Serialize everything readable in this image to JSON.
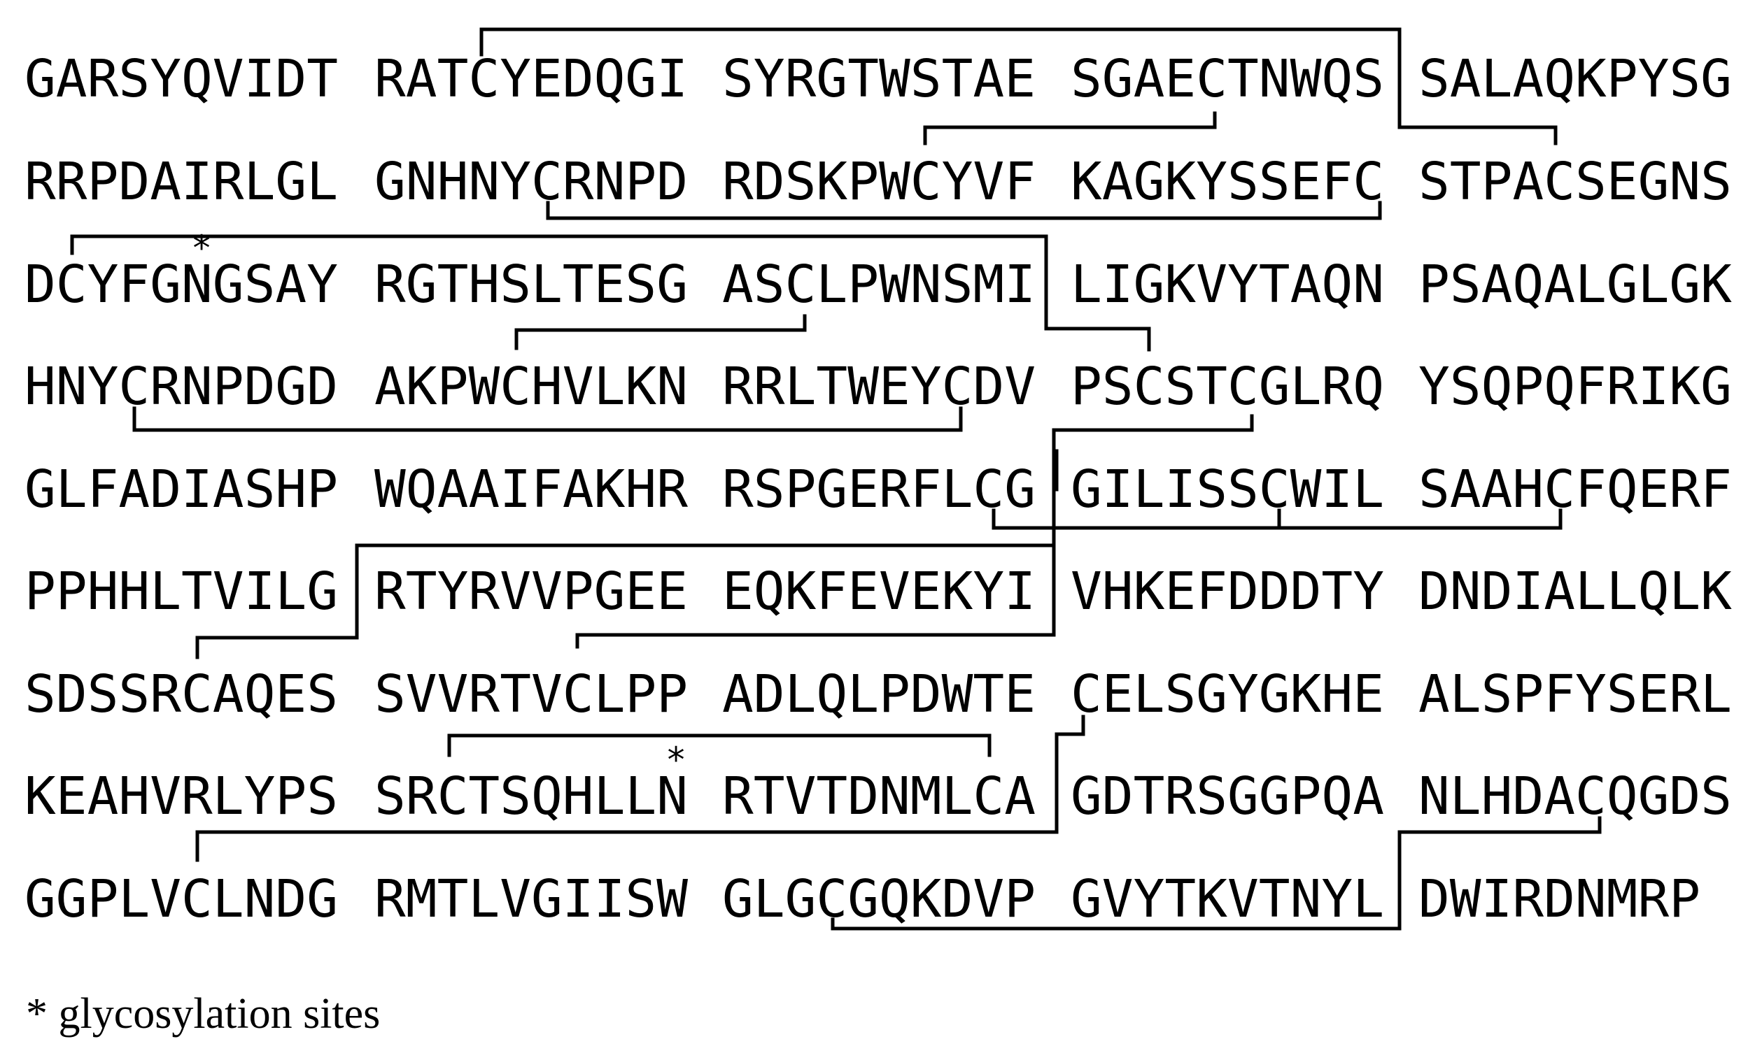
{
  "sequence": {
    "rows": [
      [
        "GARSYQVIDT",
        "RATCYEDQGI",
        "SYRGTWSTAE",
        "SGAECTNWQS",
        "SALAQKPYSG"
      ],
      [
        "RRPDAIRLGL",
        "GNHNYCRNPD",
        "RDSKPWCYVF",
        "KAGKYSSEFC",
        "STPACSEGNS"
      ],
      [
        "DCYFGNGSAY",
        "RGTHSLTESG",
        "ASCLPWNSMI",
        "LIGKVYTAQN",
        "PSAQALGLGK"
      ],
      [
        "HNYCRNPDGD",
        "AKPWCHVLKN",
        "RRLTWEYCDV",
        "PSCSTCGLRQ",
        "YSQPQFRIKG"
      ],
      [
        "GLFADIASHP",
        "WQAAIFAKHR",
        "RSPGERFLCG",
        "GILISSCWIL",
        "SAAHCFQERF"
      ],
      [
        "PPHHLTVILG",
        "RTYRVVPGEE",
        "EQKFEVEKYI",
        "VHKEFDDDTY",
        "DNDIALLQLK"
      ],
      [
        "SDSSRCAQES",
        "SVVRTVCLPP",
        "ADLQLPDWTE",
        "CELSGYGKHE",
        "ALSPFYSERL"
      ],
      [
        "KEAHVRLYPS",
        "SRCTSQHLLN",
        "RTVTDNMLCA",
        "GDTRSGGPQA",
        "NLHDACQGDS"
      ],
      [
        "GGPLVCLNDG",
        "RMTLVGIISW",
        "GLGCGQKDVP",
        "GVYTKVTNYL",
        "DWIRDNMRP"
      ]
    ]
  },
  "glycosylation_marker": "*",
  "legend": {
    "text": "* glycosylation sites"
  }
}
